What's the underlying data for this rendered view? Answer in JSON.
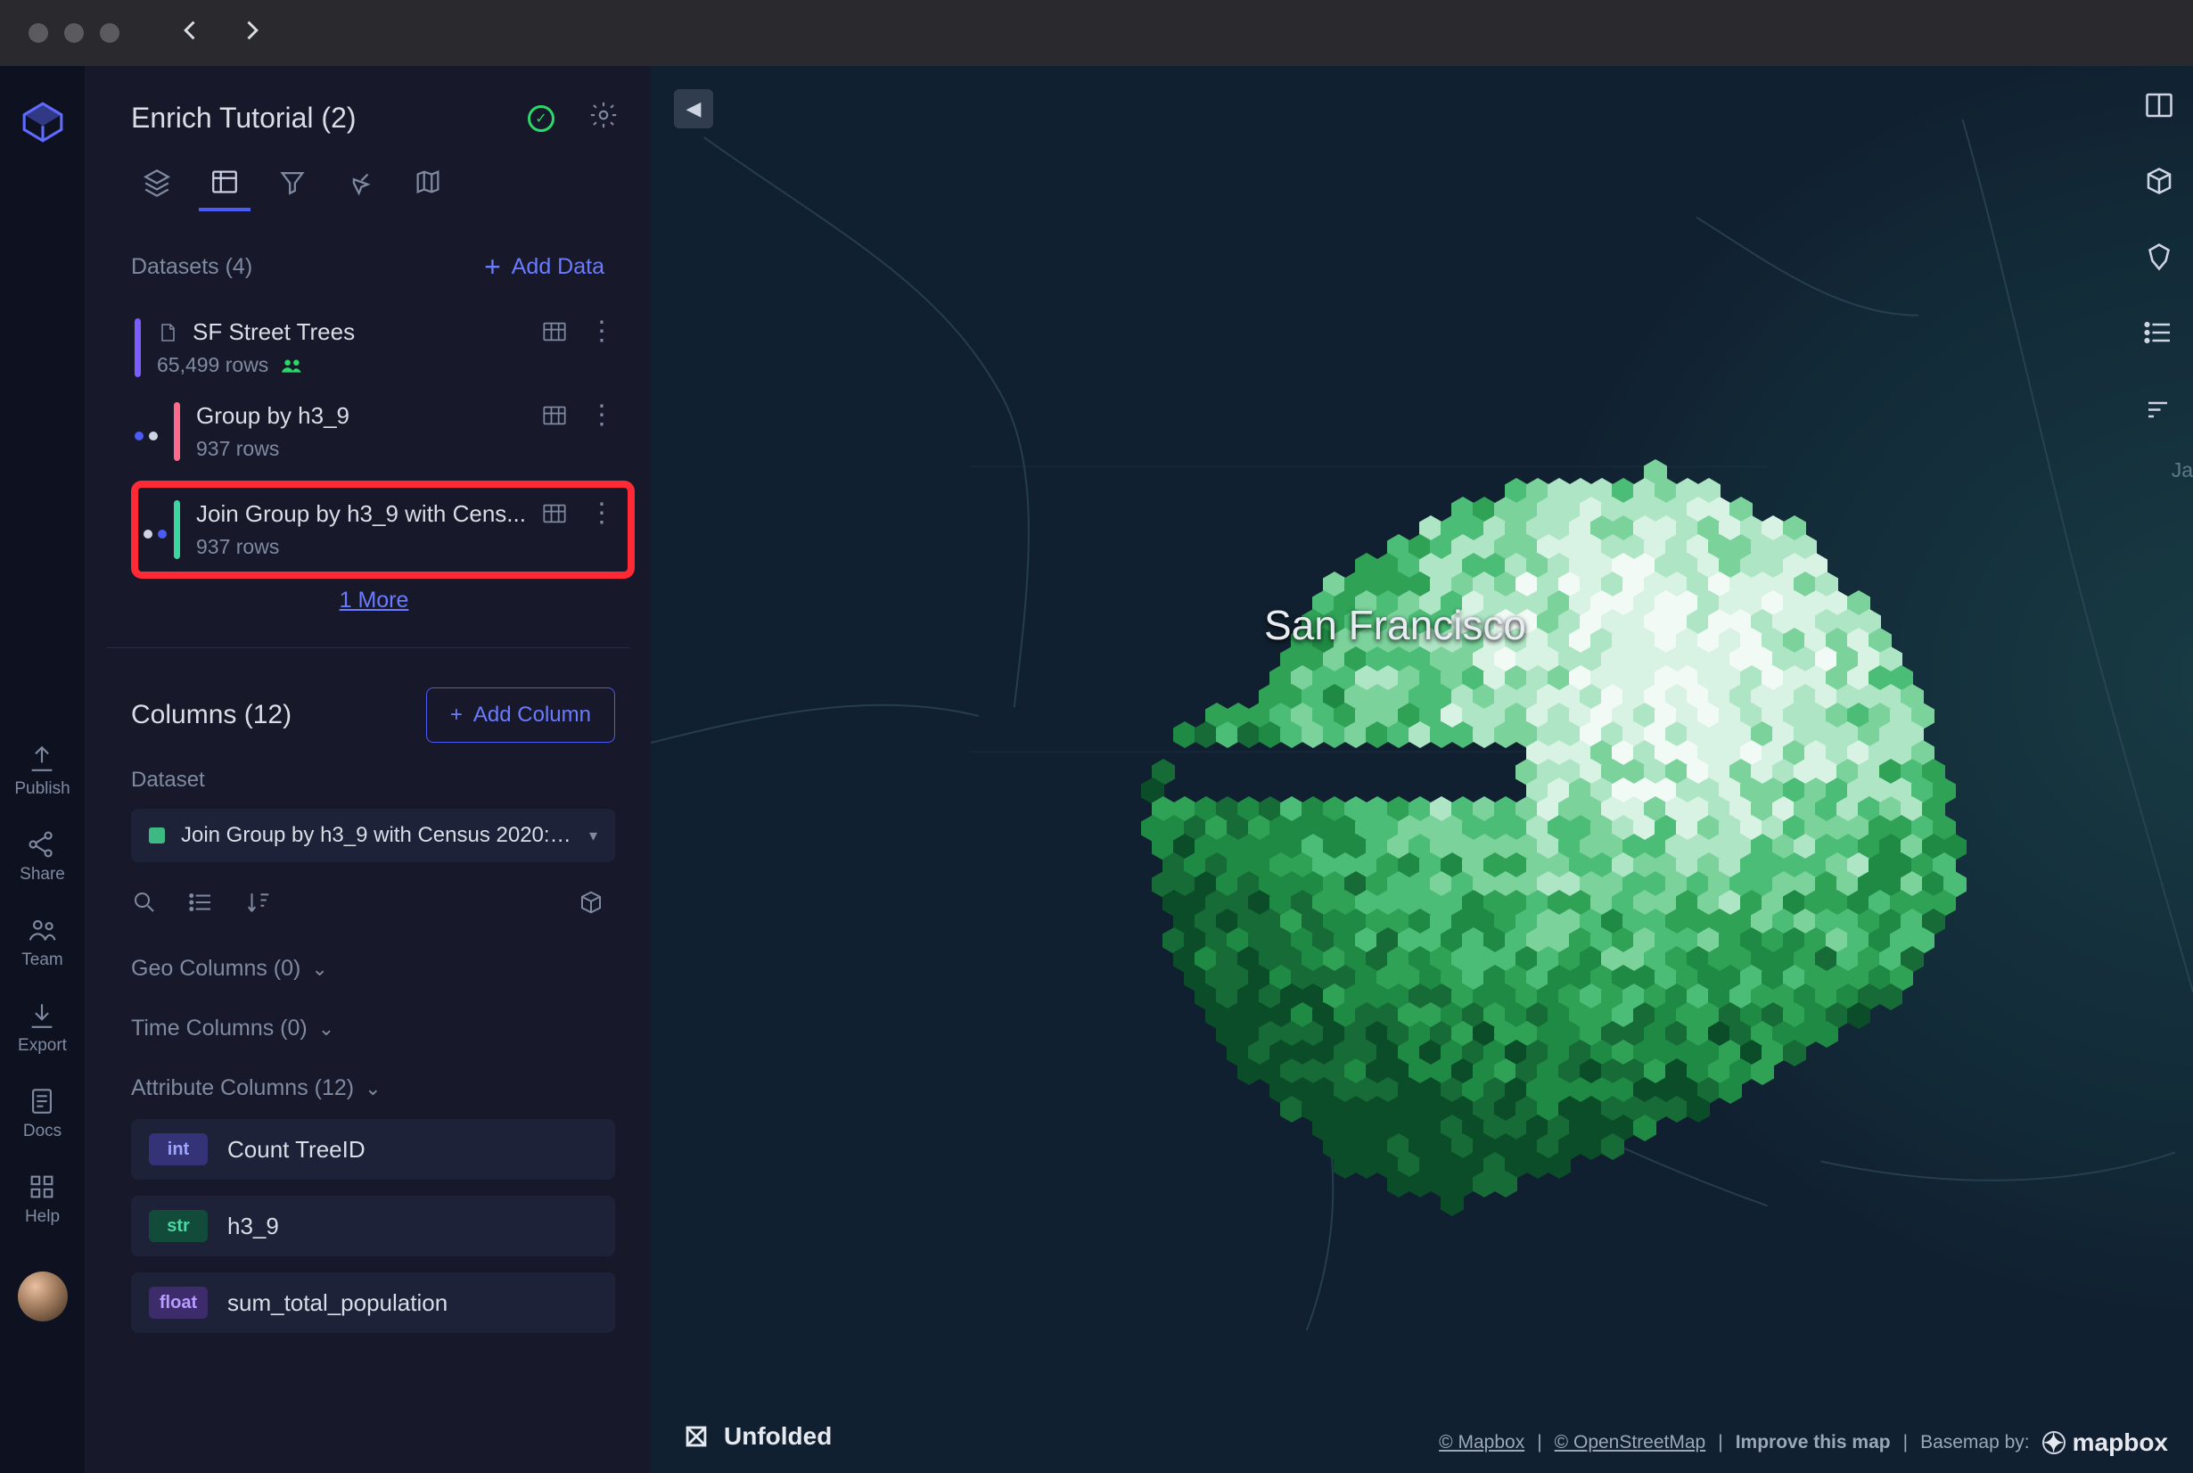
{
  "window": {
    "title": "Enrich Tutorial (2)"
  },
  "sidebar": {
    "datasets_header": "Datasets (4)",
    "add_data_label": "Add Data",
    "more_link": "1 More",
    "columns_header": "Columns (12)",
    "add_column_label": "Add Column",
    "dataset_select_label": "Dataset",
    "selected_dataset": "Join Group by h3_9 with Census 2020: ...",
    "groups": {
      "geo": "Geo Columns (0)",
      "time": "Time Columns (0)",
      "attr": "Attribute Columns (12)"
    },
    "datasets": [
      {
        "name": "SF Street Trees",
        "rows": "65,499 rows",
        "bar": "#7a5cff",
        "has_doc_icon": true,
        "has_people": true
      },
      {
        "name": "Group by h3_9",
        "rows": "937 rows",
        "bar": "#ff6a8a"
      },
      {
        "name": "Join Group by h3_9 with Cens...",
        "rows": "937 rows",
        "bar": "#3dd6a0",
        "highlight": true
      }
    ],
    "attribute_columns": [
      {
        "type": "int",
        "name": "Count TreeID"
      },
      {
        "type": "str",
        "name": "h3_9"
      },
      {
        "type": "float",
        "name": "sum_total_population"
      }
    ]
  },
  "rail": {
    "publish": "Publish",
    "share": "Share",
    "team": "Team",
    "export": "Export",
    "docs": "Docs",
    "help": "Help"
  },
  "map": {
    "city_label": "San Francisco",
    "edge_label": "Ja",
    "brand": "Unfolded",
    "attrib": {
      "mapbox": "© Mapbox",
      "osm": "© OpenStreetMap",
      "improve": "Improve this map",
      "basemap_by": "Basemap by:",
      "logo": "mapbox"
    }
  },
  "colors": {
    "accent": "#4b5cf6",
    "highlight": "#ff2a36"
  }
}
